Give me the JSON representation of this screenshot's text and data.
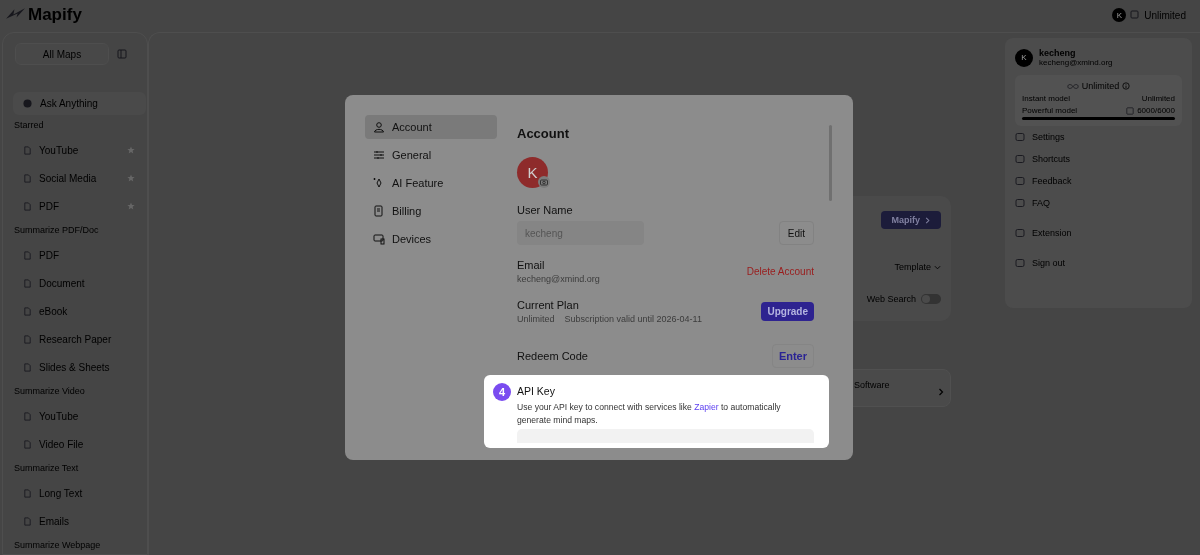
{
  "header": {
    "logo": "Mapify",
    "avatar_letter": "K",
    "plan": "Unlimited"
  },
  "sidebar": {
    "all_maps": "All Maps",
    "ask": "Ask Anything",
    "sections": [
      {
        "title": "Starred",
        "items": [
          {
            "label": "YouTube",
            "starred": true
          },
          {
            "label": "Social Media",
            "starred": true
          },
          {
            "label": "PDF",
            "starred": true
          }
        ]
      },
      {
        "title": "Summarize PDF/Doc",
        "items": [
          {
            "label": "PDF",
            "starred": false
          },
          {
            "label": "Document",
            "starred": false
          },
          {
            "label": "eBook",
            "starred": false
          },
          {
            "label": "Research Paper",
            "starred": false
          },
          {
            "label": "Slides & Sheets",
            "starred": false
          }
        ]
      },
      {
        "title": "Summarize Video",
        "items": [
          {
            "label": "YouTube",
            "starred": false
          },
          {
            "label": "Video File",
            "starred": false
          }
        ]
      },
      {
        "title": "Summarize Text",
        "items": [
          {
            "label": "Long Text",
            "starred": false
          },
          {
            "label": "Emails",
            "starred": false
          }
        ]
      },
      {
        "title": "Summarize Webpage"
      }
    ]
  },
  "main": {
    "mapify_button": "Mapify",
    "template": "Template",
    "web_search": {
      "label": "Web Search",
      "on": false
    },
    "card_label": "Software"
  },
  "user_menu": {
    "avatar_letter": "K",
    "name": "kecheng",
    "email": "kecheng@xmind.org",
    "plan": "Unlimited",
    "quotas": [
      {
        "label": "Instant model",
        "value": "Unlimited"
      },
      {
        "label": "Powerful model",
        "value": "6000/6000",
        "level": 1
      }
    ],
    "items": [
      "Settings",
      "Shortcuts",
      "Feedback",
      "FAQ",
      "Extension",
      "Sign out"
    ]
  },
  "settings": {
    "nav": [
      {
        "label": "Account",
        "selected": true
      },
      {
        "label": "General",
        "selected": false
      },
      {
        "label": "AI Feature",
        "selected": false
      },
      {
        "label": "Billing",
        "selected": false
      },
      {
        "label": "Devices",
        "selected": false
      }
    ],
    "title": "Account",
    "avatar_letter": "K",
    "user_name": {
      "label": "User Name",
      "value": "kecheng",
      "button": "Edit"
    },
    "email": {
      "label": "Email",
      "value": "kecheng@xmind.org",
      "action": "Delete Account"
    },
    "plan": {
      "label": "Current Plan",
      "name": "Unlimited",
      "validity": "Subscription valid until 2026-04-11",
      "button": "Upgrade"
    },
    "redeem": {
      "label": "Redeem Code",
      "button": "Enter"
    },
    "api_key": {
      "step": "4",
      "title": "API Key",
      "text_before": "Use your API key to connect with services like",
      "link": "Zapier",
      "text_after": "to automatically generate mind maps."
    }
  }
}
